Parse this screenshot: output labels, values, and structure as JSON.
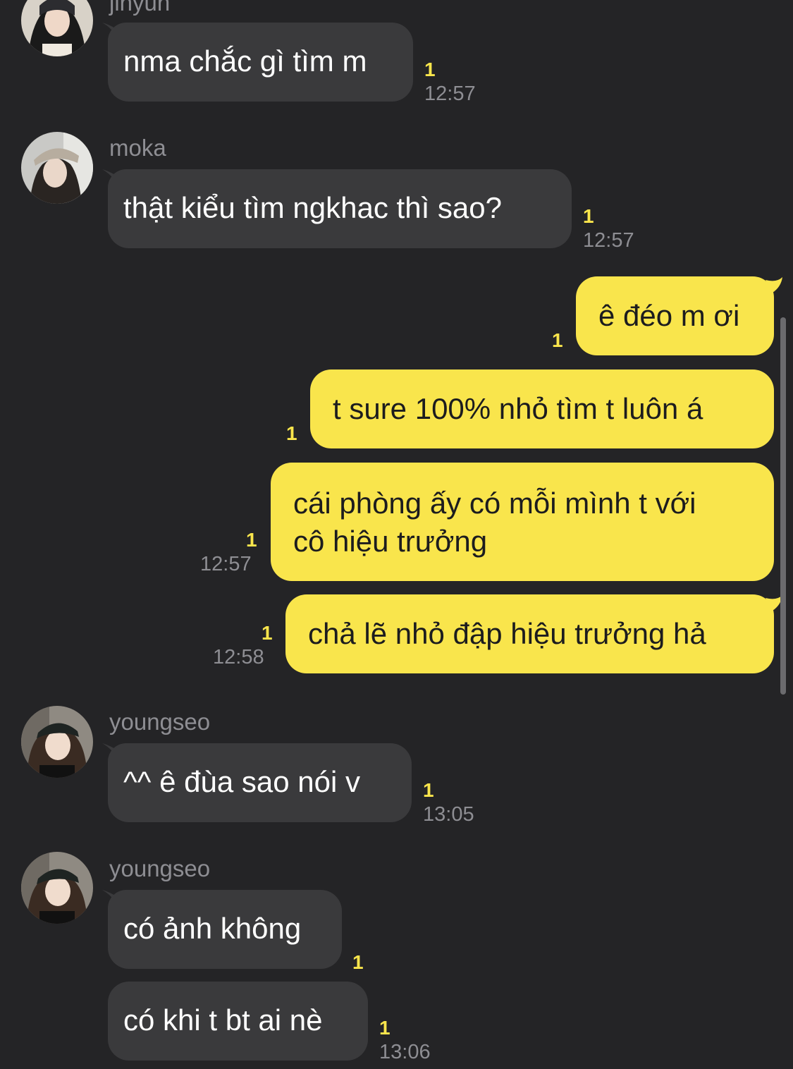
{
  "theme": {
    "background": "#242426",
    "incoming_bubble": "#3a3a3c",
    "outgoing_bubble": "#f9e54c",
    "unread_color": "#f9e54c",
    "meta_color": "#8e8e93"
  },
  "messages": [
    {
      "sender": "jinyun",
      "text": "nma chắc gì tìm m",
      "unread": "1",
      "time": "12:57"
    },
    {
      "sender": "moka",
      "text": "thật kiểu tìm ngkhac thì sao?",
      "unread": "1",
      "time": "12:57"
    },
    {
      "sender": "me",
      "text": "ê đéo m ơi",
      "unread": "1"
    },
    {
      "sender": "me",
      "text": "t sure 100% nhỏ tìm t luôn á",
      "unread": "1"
    },
    {
      "sender": "me",
      "line1": "cái phòng ấy có mỗi mình t với",
      "line2": "cô hiệu trưởng",
      "unread": "1",
      "time": "12:57"
    },
    {
      "sender": "me",
      "text": "chả lẽ nhỏ đập hiệu trưởng hả",
      "unread": "1",
      "time": "12:58"
    },
    {
      "sender": "youngseo",
      "text": "^^ ê đùa sao nói v",
      "unread": "1",
      "time": "13:05"
    },
    {
      "sender": "youngseo",
      "text": "có ảnh không",
      "unread": "1"
    },
    {
      "sender": "youngseo",
      "text": "có khi t bt ai nè",
      "unread": "1",
      "time": "13:06"
    }
  ]
}
